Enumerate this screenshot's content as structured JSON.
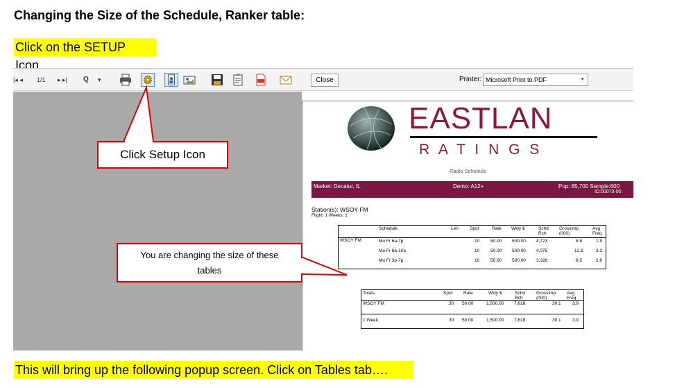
{
  "heading": "Changing the Size of the Schedule, Ranker table:",
  "instruction_top": "Click on the SETUP Icon.",
  "instruction_bottom": "This will bring up the following popup screen.  Click on Tables tab….",
  "toolbar": {
    "first": "|◂ ◂",
    "page": "1/1",
    "next": "▸ ▸|",
    "zoom": "Q",
    "zoom_drop": "▾",
    "close_label": "Close",
    "printer_label": "Printer:",
    "printer_value": "Microsoft Print to PDF",
    "icons": [
      "printer-icon",
      "setup-gear-icon",
      "portrait-icon",
      "landscape-icon",
      "save-icon",
      "clipboard-icon",
      "pdf-icon",
      "email-icon"
    ]
  },
  "callouts": {
    "setup": "Click Setup Icon",
    "tables": "You are changing the size of these tables"
  },
  "report": {
    "brand_top": "EASTLAN",
    "brand_bottom": "R A T I N G S",
    "subtitle": "Radio Schedule",
    "market": "Market: Decatur, IL",
    "demo": "Demo: A12+",
    "pop": "Pop: 85,700  Sample:600",
    "id": "ID:00073-00",
    "station": "Station(s): WSOY FM",
    "flight": "Flight: 1    Weeks: 1",
    "schedule_table": {
      "headers": [
        "Schedule",
        "Len",
        "Spot",
        "Rate",
        "Wkly $",
        "Schd Rch",
        "GrossImp (000)",
        "Avg Freq"
      ],
      "station": "WSOY FM",
      "rows": [
        [
          "Mo Fr 6a-7p",
          "",
          "10",
          "50.00",
          "500.00",
          "4,723",
          "8.8",
          "1.9"
        ],
        [
          "Mo Fr 6a-10a",
          "",
          "10",
          "50.00",
          "500.00",
          "4,075",
          "12.8",
          "3.2"
        ],
        [
          "Mo Fr 3p-7p",
          "",
          "10",
          "50.00",
          "500.00",
          "3,328",
          "8.5",
          "2.6"
        ]
      ]
    },
    "totals_table": {
      "headers": [
        "Totals",
        "Spot",
        "Rate",
        "Wkly $",
        "Schd Rch",
        "GrossImp (000)",
        "Avg Freq"
      ],
      "rows": [
        [
          "WSOY FM",
          "30",
          "50.00",
          "1,500.00",
          "7,618",
          "30.1",
          "3.9"
        ],
        [
          "1 Week:",
          "30",
          "50.00",
          "1,500.00",
          "7,618",
          "30.1",
          "3.9"
        ]
      ]
    }
  },
  "colors": {
    "highlight": "#ffff00",
    "callout_border": "#e00000",
    "banner": "#7a1740",
    "brand": "#8b1a3a"
  }
}
